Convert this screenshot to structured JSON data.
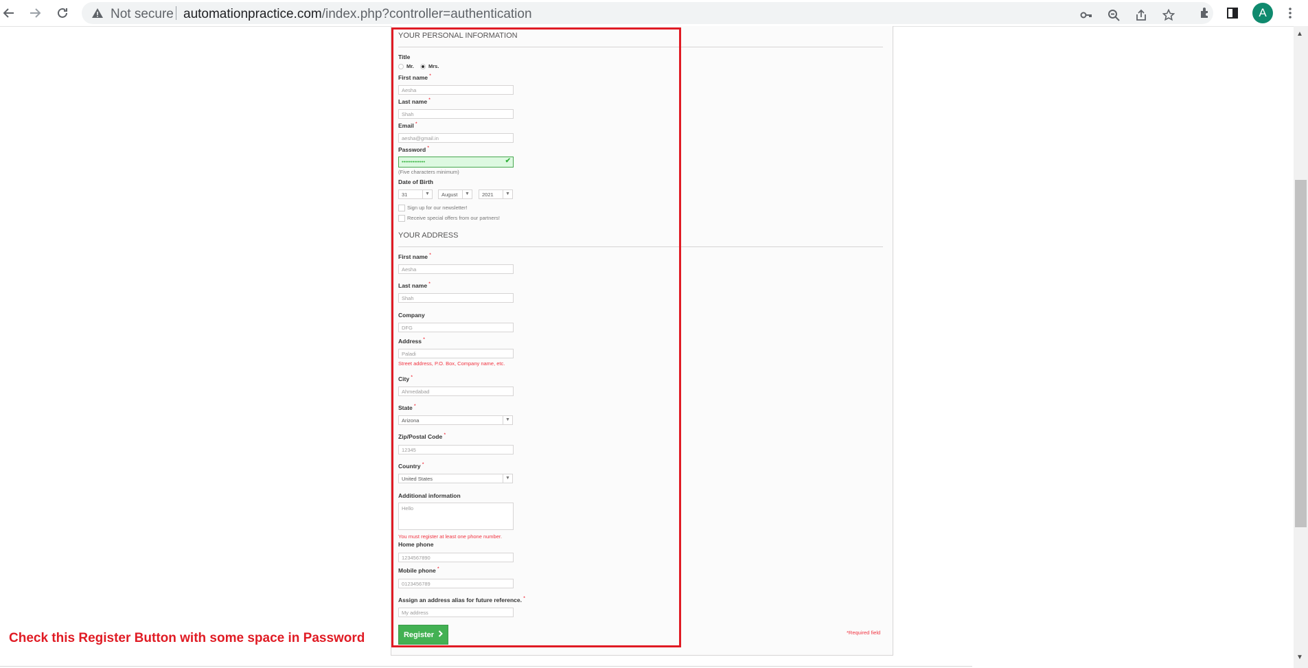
{
  "browser": {
    "security_label": "Not secure",
    "url_host": "automationpractice.com",
    "url_path": "/index.php?controller=authentication",
    "avatar_letter": "A",
    "icons": [
      "back-arrow-icon",
      "forward-arrow-icon",
      "reload-icon",
      "warning-icon",
      "key-icon",
      "zoom-icon",
      "share-icon",
      "star-icon",
      "extensions-icon",
      "side-panel-icon",
      "kebab-menu-icon"
    ]
  },
  "form": {
    "personal_title": "YOUR PERSONAL INFORMATION",
    "title_label": "Title",
    "mr_label": "Mr.",
    "mrs_label": "Mrs.",
    "selected_title": "Mrs.",
    "first_name_label": "First name",
    "first_name_value": "Aesha",
    "last_name_label": "Last name",
    "last_name_value": "Shah",
    "email_label": "Email",
    "email_value": "aesha@gmail.in",
    "password_label": "Password",
    "password_value": "•••••••••••••",
    "password_hint": "(Five characters minimum)",
    "dob_label": "Date of Birth",
    "dob_day": "31",
    "dob_month": "August",
    "dob_year": "2021",
    "newsletter_label": "Sign up for our newsletter!",
    "offers_label": "Receive special offers from our partners!",
    "address_title": "YOUR ADDRESS",
    "addr_first_name_label": "First name",
    "addr_first_name_value": "Aesha",
    "addr_last_name_label": "Last name",
    "addr_last_name_value": "Shah",
    "company_label": "Company",
    "company_value": "DFG",
    "address_label": "Address",
    "address_value": "Paladi",
    "address_hint": "Street address, P.O. Box, Company name, etc.",
    "city_label": "City",
    "city_value": "Ahmedabad",
    "state_label": "State",
    "state_value": "Arizona",
    "zip_label": "Zip/Postal Code",
    "zip_value": "12345",
    "country_label": "Country",
    "country_value": "United States",
    "additional_label": "Additional information",
    "additional_value": "Hello",
    "phone_warning": "You must register at least one phone number.",
    "home_phone_label": "Home phone",
    "home_phone_value": "1234567890",
    "mobile_phone_label": "Mobile phone",
    "mobile_phone_value": "0123456789",
    "alias_label": "Assign an address alias for future reference.",
    "alias_value": "My address",
    "register_label": "Register",
    "required_note": "*Required field",
    "required_mark": "*"
  },
  "annotation": {
    "text": "Check this Register Button with some space in Password",
    "color": "#e01b24"
  }
}
